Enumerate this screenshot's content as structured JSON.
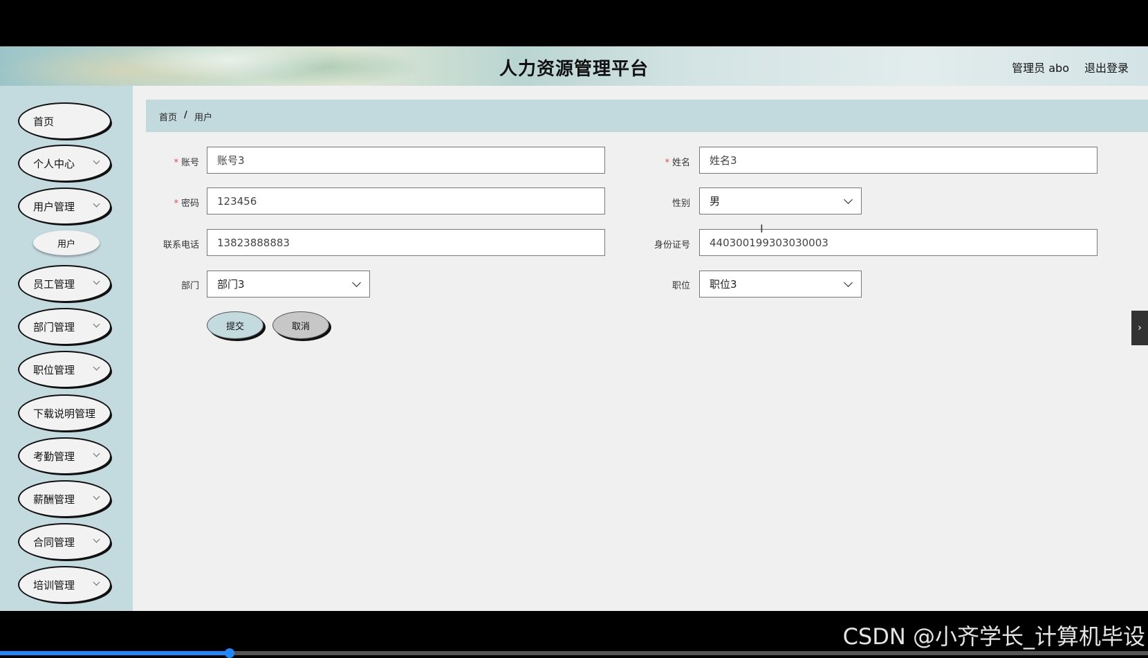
{
  "header": {
    "title": "人力资源管理平台",
    "user": "管理员 abo",
    "logout": "退出登录"
  },
  "sidebar": {
    "items": [
      {
        "label": "首页",
        "has_children": false
      },
      {
        "label": "个人中心",
        "has_children": true
      },
      {
        "label": "用户管理",
        "has_children": true
      },
      {
        "label": "员工管理",
        "has_children": true
      },
      {
        "label": "部门管理",
        "has_children": true
      },
      {
        "label": "职位管理",
        "has_children": true
      },
      {
        "label": "下载说明管理",
        "has_children": false
      },
      {
        "label": "考勤管理",
        "has_children": true
      },
      {
        "label": "薪酬管理",
        "has_children": true
      },
      {
        "label": "合同管理",
        "has_children": true
      },
      {
        "label": "培训管理",
        "has_children": true
      }
    ],
    "sub_item": "用户"
  },
  "breadcrumb": {
    "home": "首页",
    "separator": "/",
    "current": "用户"
  },
  "form": {
    "account": {
      "label": "账号",
      "value": "账号3",
      "required": true
    },
    "name": {
      "label": "姓名",
      "value": "姓名3",
      "required": true
    },
    "password": {
      "label": "密码",
      "value": "123456",
      "required": true
    },
    "gender": {
      "label": "性别",
      "value": "男"
    },
    "phone": {
      "label": "联系电话",
      "value": "13823888883"
    },
    "idcard": {
      "label": "身份证号",
      "value": "440300199303030003"
    },
    "department": {
      "label": "部门",
      "value": "部门3"
    },
    "position": {
      "label": "职位",
      "value": "职位3"
    },
    "submit": "提交",
    "cancel": "取消",
    "required_mark": "*"
  },
  "side_toggle": "›",
  "watermark": "CSDN @小齐学长_计算机毕设",
  "video_progress": 0.2,
  "colors": {
    "sidebar_bg": "#c3dadf",
    "breadcrumb_bg": "#c2d9de",
    "required": "#e24a4a",
    "progress": "#1e88ff"
  }
}
